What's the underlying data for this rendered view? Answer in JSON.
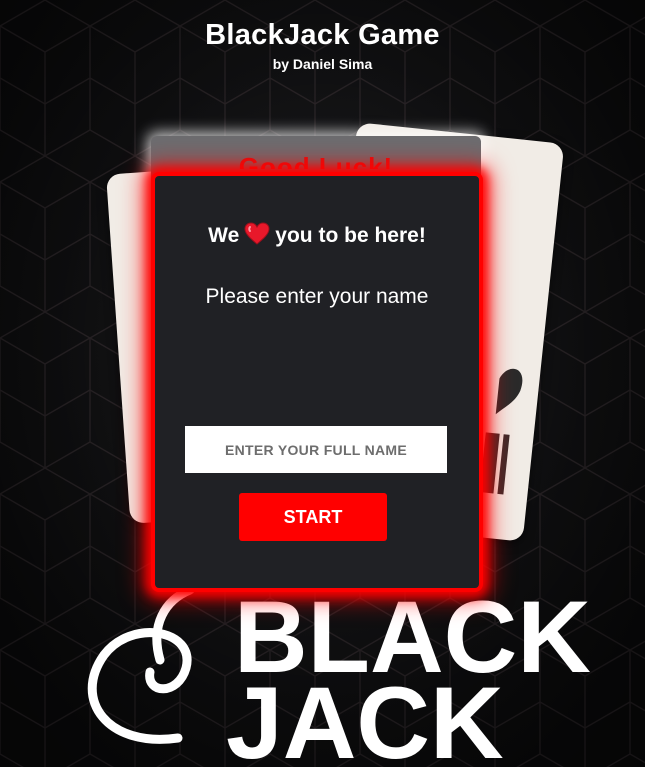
{
  "header": {
    "title": "BlackJack Game",
    "author": "by Daniel Sima"
  },
  "modal": {
    "welcome_prefix": "We",
    "welcome_icon": "heart-icon",
    "welcome_suffix": "you to be here!",
    "prompt": "Please enter your name",
    "name_input": {
      "placeholder": "ENTER YOUR FULL NAME",
      "value": ""
    },
    "start_label": "START"
  },
  "background_card": {
    "partial_text": "Good Luck!"
  },
  "logo": {
    "line1": "BLACK",
    "line2": "JACK"
  },
  "colors": {
    "accent": "#ff0000",
    "modal_bg": "#202125",
    "card": "#f1ece6",
    "text": "#ffffff"
  }
}
